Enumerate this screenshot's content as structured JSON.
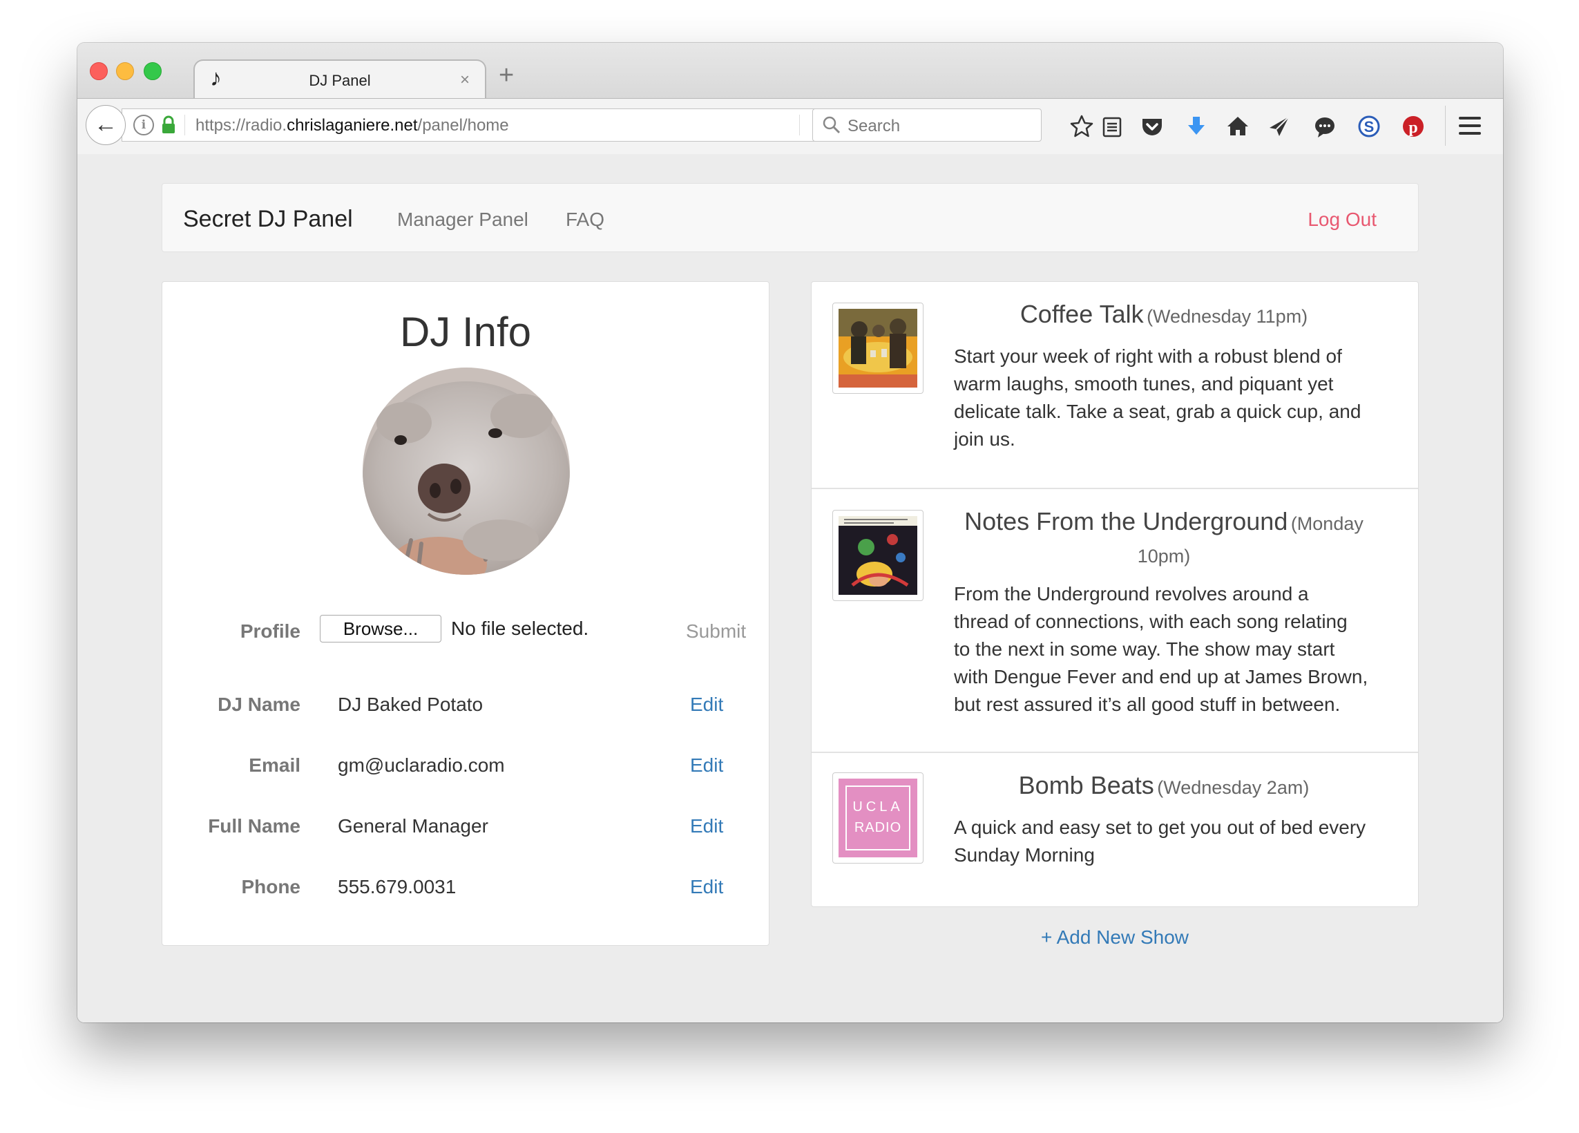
{
  "browser": {
    "tab_title": "DJ Panel",
    "tab_close": "×",
    "new_tab": "+",
    "url_prefix": "https://radio.",
    "url_host": "chrislaganiere.net",
    "url_path": "/panel/home",
    "search_placeholder": "Search",
    "toolbar_icons": [
      "star-icon",
      "reading-list-icon",
      "pocket-icon",
      "download-icon",
      "home-icon",
      "send-icon",
      "chat-icon",
      "s-extension-icon",
      "pinterest-icon"
    ]
  },
  "nav": {
    "brand": "Secret DJ Panel",
    "links": [
      "Manager Panel",
      "FAQ"
    ],
    "logout": "Log Out"
  },
  "dj_info": {
    "title": "DJ Info",
    "profile_label": "Profile",
    "browse_label": "Browse...",
    "no_file": "No file selected.",
    "submit_label": "Submit",
    "edit_label": "Edit",
    "fields": [
      {
        "label": "DJ Name",
        "value": "DJ Baked Potato"
      },
      {
        "label": "Email",
        "value": "gm@ucla​radio.com"
      },
      {
        "label": "Full Name",
        "value": "General Manager"
      },
      {
        "label": "Phone",
        "value": "555.679.0031"
      }
    ]
  },
  "shows": [
    {
      "name": "Coffee Talk",
      "time": "(Wednesday 11pm)",
      "description": "Start your week of right with a robust blend of warm laughs, smooth tunes, and piquant yet delicate talk. Take a seat, grab a quick cup, and join us."
    },
    {
      "name": "Notes From the Underground",
      "time": "(Monday 10pm)",
      "description": "From the Underground revolves around a thread of connections, with each song relating to the next in some way. The show may start with Dengue Fever and end up at James Brown, but rest assured it’s all good stuff in between."
    },
    {
      "name": "Bomb Beats",
      "time": "(Wednesday 2am)",
      "description": "A quick and easy set to get you out of bed every Sunday Morning",
      "logo_text_1": "UCLA",
      "logo_text_2": "RADIO"
    }
  ],
  "add_show": "+ Add New Show",
  "colors": {
    "link": "#337ab7",
    "logout": "#e85870",
    "ucla_pink": "#e38fc2"
  }
}
